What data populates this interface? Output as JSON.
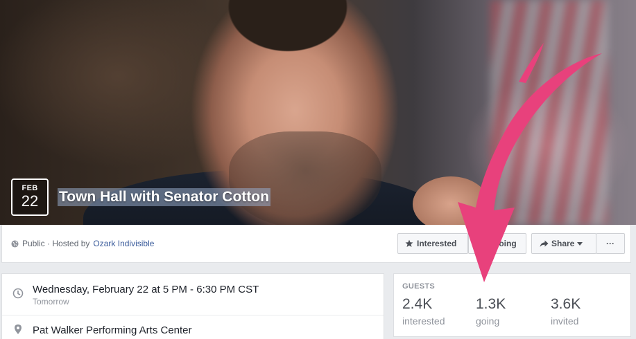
{
  "colors": {
    "link": "#365899",
    "secondary_text": "#90949c",
    "page_background": "#e9ebee",
    "annotation_arrow": "#e8417c"
  },
  "cover": {
    "date_badge": {
      "month": "FEB",
      "day": "22"
    },
    "title": "Town Hall with Senator Cotton"
  },
  "action_bar": {
    "privacy_prefix": "Public · Hosted by",
    "host_name": "Ozark Indivisible",
    "interested_label": "Interested",
    "going_label": "Going",
    "share_label": "Share",
    "more_label": "···"
  },
  "details": {
    "time_main": "Wednesday, February 22 at 5 PM - 6:30 PM CST",
    "time_sub": "Tomorrow",
    "place_name": "Pat Walker Performing Arts Center"
  },
  "guests": {
    "heading": "GUESTS",
    "stats": [
      {
        "value": "2.4K",
        "label": "interested"
      },
      {
        "value": "1.3K",
        "label": "going"
      },
      {
        "value": "3.6K",
        "label": "invited"
      }
    ]
  },
  "icons": {
    "globe": "globe-icon",
    "star": "star-icon",
    "share_arrow": "share-arrow-icon",
    "caret": "caret-down-icon",
    "clock": "clock-icon",
    "pin": "location-pin-icon"
  }
}
